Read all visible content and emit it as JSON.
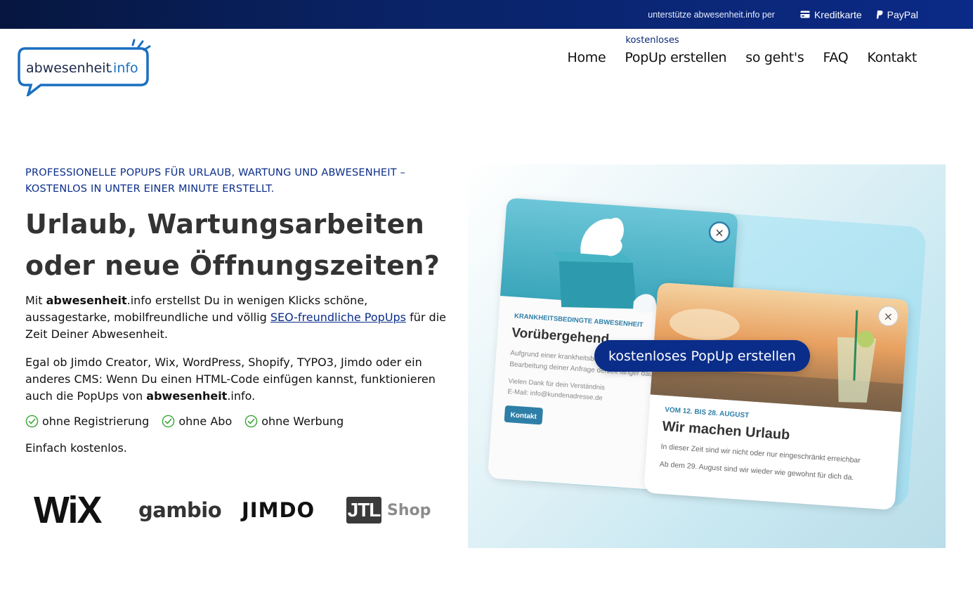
{
  "topbar": {
    "support_text": "unterstütze abwesenheit.info per",
    "credit_label": "Kreditkarte",
    "paypal_label": "PayPal"
  },
  "header": {
    "logo_text_main": "abwesenheit",
    "logo_text_tld": ".info",
    "nav": {
      "home": "Home",
      "popup_over": "kostenloses",
      "popup": "PopUp erstellen",
      "howto": "so geht's",
      "faq": "FAQ",
      "contact": "Kontakt"
    }
  },
  "hero": {
    "eyebrow_line1": "PROFESSIONELLE POPUPS FÜR URLAUB, WARTUNG UND ABWESENHEIT –",
    "eyebrow_line2": "KOSTENLOS IN UNTER EINER MINUTE ERSTELLT.",
    "headline_line1": "Urlaub, Wartungsarbeiten",
    "headline_line2": "oder neue Öffnungszeiten?",
    "p1_prefix": "Mit ",
    "p1_brand": "abwesenheit",
    "p1_mid": ".info erstellst Du in wenigen Klicks schöne, aussagestarke, mobilfreundliche und völlig ",
    "p1_link": "SEO-freundliche PopUps",
    "p1_suffix": " für die Zeit Deiner Abwesenheit.",
    "p2_prefix": "Egal ob Jimdo Creator, Wix, WordPress, Shopify, TYPO3, Jimdo oder ein anderes CMS: Wenn Du einen HTML-Code einfügen kannst, funktionieren auch die PopUps von ",
    "p2_brand": "abwesenheit",
    "p2_suffix": ".info.",
    "features": [
      "ohne Registrierung",
      "ohne Abo",
      "ohne Werbung"
    ],
    "tagline": "Einfach kostenlos.",
    "cta_label": "kostenloses PopUp erstellen"
  },
  "logos": {
    "wix": "WiX",
    "gambio": "gambio",
    "jimdo": "JIMDO",
    "jtl": "JTL",
    "jtl_shop": "Shop"
  },
  "illustration": {
    "popup1": {
      "tag": "KRANKHEITSBEDINGTE ABWESENHEIT",
      "title": "Vorübergehend",
      "body1": "Aufgrund einer krankheitsbed",
      "body2": "Bearbeitung deiner Anfrage derzeit länger dauern",
      "thanks": "Vielen Dank für dein Verständnis",
      "email": "E-Mail: info@kundenadresse.de",
      "button": "Kontakt"
    },
    "popup2": {
      "tag": "VOM 12. BIS 28. AUGUST",
      "title": "Wir machen Urlaub",
      "body1": "In dieser Zeit sind wir nicht oder nur eingeschränkt erreichbar",
      "body2": "Ab dem 29. August sind wir wieder wie gewohnt für dich da."
    },
    "close_glyph": "×"
  },
  "colors": {
    "brand_navy": "#0b2d8a",
    "topbar_dark": "#06163f",
    "logo_blue": "#1a6fc0",
    "check_green": "#3aa535"
  }
}
